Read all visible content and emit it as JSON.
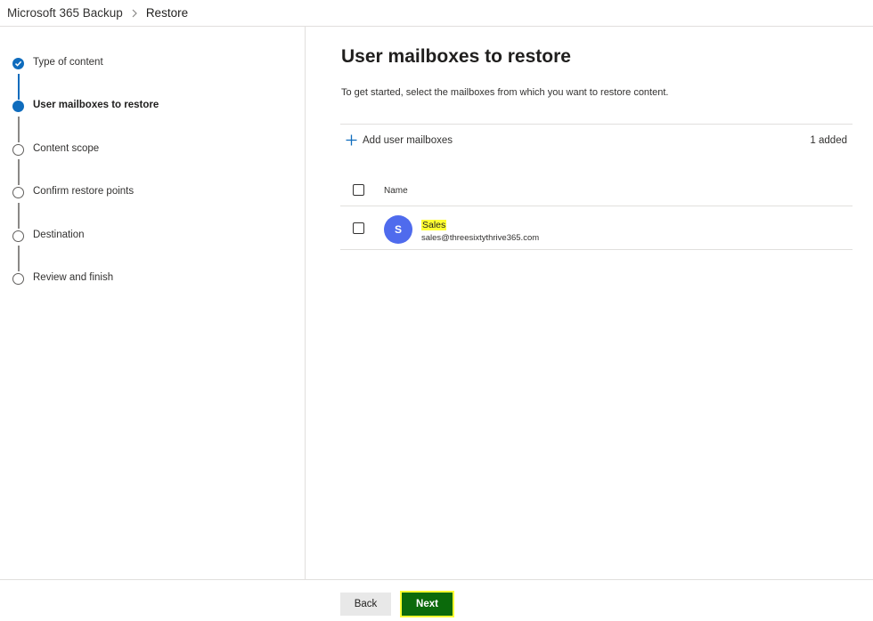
{
  "breadcrumb": {
    "parent": "Microsoft 365 Backup",
    "current": "Restore"
  },
  "steps": [
    {
      "label": "Type of content",
      "state": "done"
    },
    {
      "label": "User mailboxes to restore",
      "state": "current"
    },
    {
      "label": "Content scope",
      "state": "pending"
    },
    {
      "label": "Confirm restore points",
      "state": "pending"
    },
    {
      "label": "Destination",
      "state": "pending"
    },
    {
      "label": "Review and finish",
      "state": "pending"
    }
  ],
  "main": {
    "title": "User mailboxes to restore",
    "description": "To get started, select the mailboxes from which you want to restore content.",
    "toolbar": {
      "add_label": "Add user mailboxes",
      "added_count": "1 added"
    },
    "table": {
      "column_name": "Name",
      "rows": [
        {
          "initial": "S",
          "name": "Sales",
          "email": "sales@threesixtythrive365.com"
        }
      ]
    }
  },
  "footer": {
    "back_label": "Back",
    "next_label": "Next"
  },
  "colors": {
    "accent": "#0f6cbd",
    "avatar": "#4f6bed",
    "next_button": "#0b6a0b",
    "highlight": "#ffff32"
  }
}
